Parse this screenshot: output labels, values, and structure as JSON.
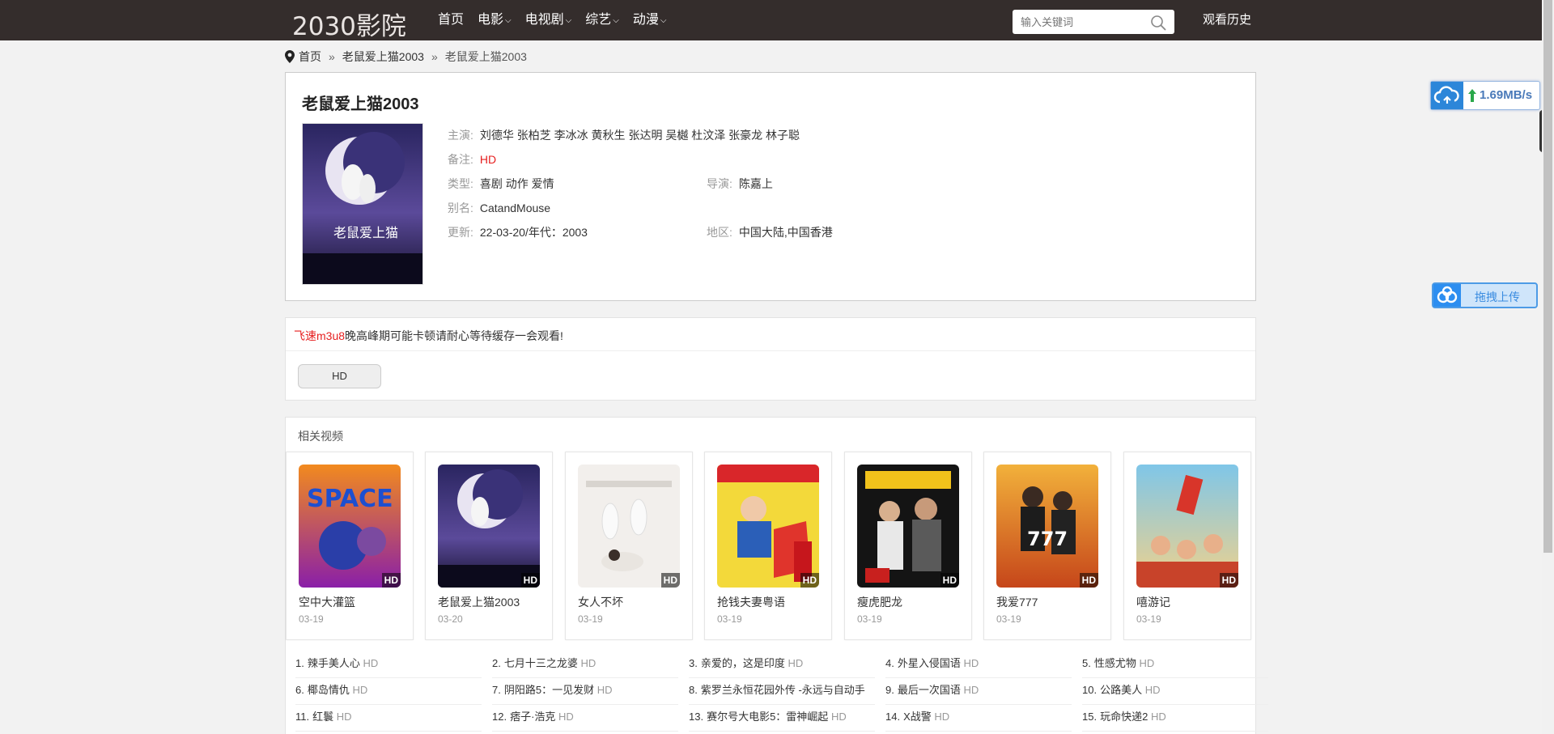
{
  "site": {
    "logo": "2030影院"
  },
  "nav": {
    "items": [
      {
        "label": "首页",
        "dropdown": false
      },
      {
        "label": "电影",
        "dropdown": true
      },
      {
        "label": "电视剧",
        "dropdown": true
      },
      {
        "label": "综艺",
        "dropdown": true
      },
      {
        "label": "动漫",
        "dropdown": true
      }
    ],
    "search_placeholder": "输入关键词",
    "history": "观看历史"
  },
  "breadcrumb": {
    "home": "首页",
    "sep": "»",
    "level1": "老鼠爱上猫2003",
    "current": "老鼠爱上猫2003"
  },
  "detail": {
    "title": "老鼠爱上猫2003",
    "cast_label": "主演:",
    "cast": "刘德华 张柏芝 李冰冰 黄秋生 张达明 吴樾 杜汶泽 张豪龙 林子聪",
    "remark_label": "备注:",
    "remark": "HD",
    "genre_label": "类型:",
    "genre": "喜剧 动作 爱情",
    "director_label": "导演:",
    "director": "陈嘉上",
    "alias_label": "别名:",
    "alias": "CatandMouse",
    "update_label": "更新:",
    "update": "22-03-20/年代：2003",
    "region_label": "地区:",
    "region": "中国大陆,中国香港"
  },
  "play": {
    "source": "飞速m3u8",
    "notice": "晚高峰期可能卡顿请耐心等待缓存一会观看!",
    "episode": "HD"
  },
  "related": {
    "title": "相关视频",
    "items": [
      {
        "name": "空中大灌篮",
        "date": "03-19",
        "badge": "HD"
      },
      {
        "name": "老鼠爱上猫2003",
        "date": "03-20",
        "badge": "HD"
      },
      {
        "name": "女人不坏",
        "date": "03-19",
        "badge": "HD"
      },
      {
        "name": "抢钱夫妻粤语",
        "date": "03-19",
        "badge": "HD"
      },
      {
        "name": "瘦虎肥龙",
        "date": "03-19",
        "badge": "HD"
      },
      {
        "name": "我爱777",
        "date": "03-19",
        "badge": "HD"
      },
      {
        "name": "嘻游记",
        "date": "03-19",
        "badge": "HD"
      }
    ]
  },
  "ranking": [
    {
      "num": "1.",
      "name": "辣手美人心",
      "tag": "HD"
    },
    {
      "num": "2.",
      "name": "七月十三之龙婆",
      "tag": "HD"
    },
    {
      "num": "3.",
      "name": "亲爱的，这是印度",
      "tag": "HD"
    },
    {
      "num": "4.",
      "name": "外星入侵国语",
      "tag": "HD"
    },
    {
      "num": "5.",
      "name": "性感尤物",
      "tag": "HD"
    },
    {
      "num": "6.",
      "name": "椰岛情仇",
      "tag": "HD"
    },
    {
      "num": "7.",
      "name": "阴阳路5：一见发财",
      "tag": "HD"
    },
    {
      "num": "8.",
      "name": "紫罗兰永恒花园外传 -永远与自动手",
      "tag": ""
    },
    {
      "num": "9.",
      "name": "最后一次国语",
      "tag": "HD"
    },
    {
      "num": "10.",
      "name": "公路美人",
      "tag": "HD"
    },
    {
      "num": "11.",
      "name": "红鬟",
      "tag": "HD"
    },
    {
      "num": "12.",
      "name": "痞子·浩克",
      "tag": "HD"
    },
    {
      "num": "13.",
      "name": "赛尔号大电影5：雷神崛起",
      "tag": "HD"
    },
    {
      "num": "14.",
      "name": "X战警",
      "tag": "HD"
    },
    {
      "num": "15.",
      "name": "玩命快递2",
      "tag": "HD"
    }
  ],
  "widgets": {
    "speed": "1.69MB/s",
    "upload": "拖拽上传"
  },
  "colors": {
    "topbar": "#342d2c",
    "accent_red": "#e61e1e",
    "widget_blue": "#2c86d9"
  }
}
